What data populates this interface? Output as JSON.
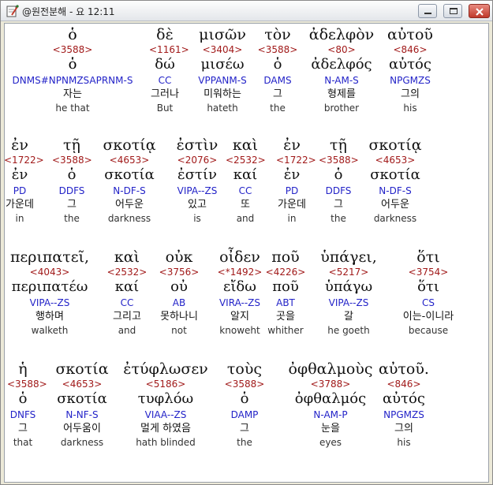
{
  "window": {
    "title": "@원전분해 - 요 12:11",
    "icon": "bible-pen-icon",
    "controls": [
      "minimize",
      "maximize",
      "close"
    ]
  },
  "rows": [
    {
      "words": [
        {
          "greek": "ὁ",
          "num": "<3588>",
          "lemma": "ὁ",
          "parse": "DNMS#NPNMZSAPRNM-S",
          "korean": "자는",
          "english": "he that",
          "selected": true
        },
        {
          "greek": "δὲ",
          "num": "<1161>",
          "lemma": "δώ",
          "parse": "CC",
          "korean": "그러나",
          "english": "But"
        },
        {
          "greek": "μισῶν",
          "num": "<3404>",
          "lemma": "μισέω",
          "parse": "VPPANM-S",
          "korean": "미워하는",
          "english": "hateth"
        },
        {
          "greek": "τὸν",
          "num": "<3588>",
          "lemma": "ὁ",
          "parse": "DAMS",
          "korean": "그",
          "english": "the"
        },
        {
          "greek": "ἀδελφὸν",
          "num": "<80>",
          "lemma": "ἀδελφός",
          "parse": "N-AM-S",
          "korean": "형제를",
          "english": "brother"
        },
        {
          "greek": "αὐτοῦ",
          "num": "<846>",
          "lemma": "αὐτός",
          "parse": "NPGMZS",
          "korean": "그의",
          "english": "his"
        }
      ]
    },
    {
      "words": [
        {
          "greek": "ἐν",
          "num": "<1722>",
          "lemma": "ἐν",
          "parse": "PD",
          "korean": "가운데",
          "english": "in"
        },
        {
          "greek": "τῇ",
          "num": "<3588>",
          "lemma": "ὁ",
          "parse": "DDFS",
          "korean": "그",
          "english": "the"
        },
        {
          "greek": "σκοτίᾳ",
          "num": "<4653>",
          "lemma": "σκοτία",
          "parse": "N-DF-S",
          "korean": "어두운",
          "english": "darkness"
        },
        {
          "greek": "ἐστὶν",
          "num": "<2076>",
          "lemma": "ἐστίν",
          "parse": "VIPA--ZS",
          "korean": "있고",
          "english": "is"
        },
        {
          "greek": "καὶ",
          "num": "<2532>",
          "lemma": "καί",
          "parse": "CC",
          "korean": "또",
          "english": "and"
        },
        {
          "greek": "ἐν",
          "num": "<1722>",
          "lemma": "ἐν",
          "parse": "PD",
          "korean": "가운데",
          "english": "in"
        },
        {
          "greek": "τῇ",
          "num": "<3588>",
          "lemma": "ὁ",
          "parse": "DDFS",
          "korean": "그",
          "english": "the"
        },
        {
          "greek": "σκοτίᾳ",
          "num": "<4653>",
          "lemma": "σκοτία",
          "parse": "N-DF-S",
          "korean": "어두운",
          "english": "darkness"
        }
      ]
    },
    {
      "words": [
        {
          "greek": "περιπατεῖ,",
          "num": "<4043>",
          "lemma": "περιπατέω",
          "parse": "VIPA--ZS",
          "korean": "행하며",
          "english": "walketh"
        },
        {
          "greek": "καὶ",
          "num": "<2532>",
          "lemma": "καί",
          "parse": "CC",
          "korean": "그리고",
          "english": "and"
        },
        {
          "greek": "οὐκ",
          "num": "<3756>",
          "lemma": "οὐ",
          "parse": "AB",
          "korean": "못하나니",
          "english": "not"
        },
        {
          "greek": "οἶδεν",
          "num": "<*1492>",
          "lemma": "εἴδω",
          "parse": "VIRA--ZS",
          "korean": "알지",
          "english": "knoweht"
        },
        {
          "greek": "ποῦ",
          "num": "<4226>",
          "lemma": "ποῦ",
          "parse": "ABT",
          "korean": "곳을",
          "english": "whither"
        },
        {
          "greek": "ὑπάγει,",
          "num": "<5217>",
          "lemma": "ὑπάγω",
          "parse": "VIPA--ZS",
          "korean": "갈",
          "english": "he goeth"
        },
        {
          "greek": "ὅτι",
          "num": "<3754>",
          "lemma": "ὅτι",
          "parse": "CS",
          "korean": "이는-이니라",
          "english": "because"
        }
      ]
    },
    {
      "words": [
        {
          "greek": "ἡ",
          "num": "<3588>",
          "lemma": "ὁ",
          "parse": "DNFS",
          "korean": "그",
          "english": "that"
        },
        {
          "greek": "σκοτία",
          "num": "<4653>",
          "lemma": "σκοτία",
          "parse": "N-NF-S",
          "korean": "어두움이",
          "english": "darkness"
        },
        {
          "greek": "ἐτύφλωσεν",
          "num": "<5186>",
          "lemma": "τυφλόω",
          "parse": "VIAA--ZS",
          "korean": "멀게 하였음",
          "english": "hath blinded"
        },
        {
          "greek": "τοὺς",
          "num": "<3588>",
          "lemma": "ὁ",
          "parse": "DAMP",
          "korean": "그",
          "english": "the"
        },
        {
          "greek": "ὀφθαλμοὺς",
          "num": "<3788>",
          "lemma": "ὀφθαλμός",
          "parse": "N-AM-P",
          "korean": "눈을",
          "english": "eyes"
        },
        {
          "greek": "αὐτοῦ.",
          "num": "<846>",
          "lemma": "αὐτός",
          "parse": "NPGMZS",
          "korean": "그의",
          "english": "his"
        }
      ]
    }
  ]
}
